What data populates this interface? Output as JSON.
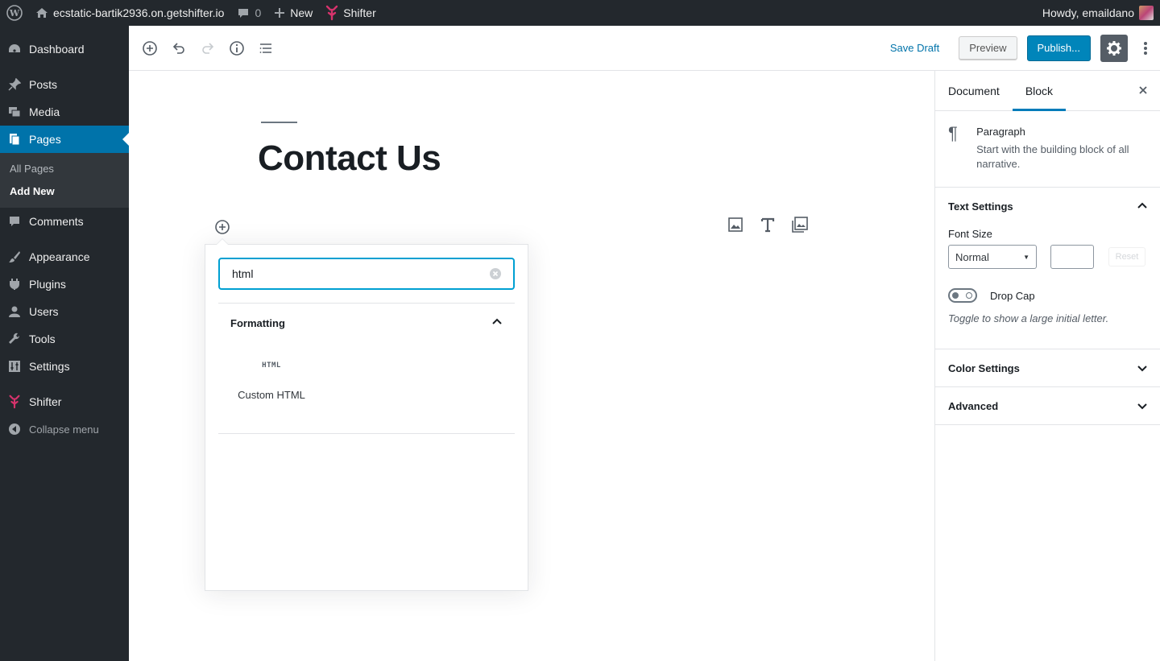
{
  "adminbar": {
    "site_name": "ecstatic-bartik2936.on.getshifter.io",
    "comments_count": "0",
    "new_label": "New",
    "shifter_label": "Shifter",
    "howdy": "Howdy, emaildano"
  },
  "sidebar": {
    "items": [
      {
        "label": "Dashboard",
        "icon": "dashboard-icon"
      },
      {
        "label": "Posts",
        "icon": "pin-icon"
      },
      {
        "label": "Media",
        "icon": "media-icon"
      },
      {
        "label": "Pages",
        "icon": "pages-icon"
      },
      {
        "label": "Comments",
        "icon": "comment-icon"
      },
      {
        "label": "Appearance",
        "icon": "brush-icon"
      },
      {
        "label": "Plugins",
        "icon": "plugin-icon"
      },
      {
        "label": "Users",
        "icon": "user-icon"
      },
      {
        "label": "Tools",
        "icon": "wrench-icon"
      },
      {
        "label": "Settings",
        "icon": "settings-icon"
      },
      {
        "label": "Shifter",
        "icon": "shifter-icon"
      }
    ],
    "submenu": [
      "All Pages",
      "Add New"
    ],
    "collapse_label": "Collapse menu",
    "accent": "#0073aa"
  },
  "header": {
    "save_draft": "Save Draft",
    "preview": "Preview",
    "publish": "Publish..."
  },
  "editor": {
    "title": "Contact Us"
  },
  "inserter": {
    "search_value": "html",
    "panel_title": "Formatting",
    "block_icon_text": "HTML",
    "block_label": "Custom HTML"
  },
  "settings": {
    "tabs": [
      "Document",
      "Block"
    ],
    "block_name": "Paragraph",
    "block_description": "Start with the building block of all narrative.",
    "text_settings": "Text Settings",
    "font_size_label": "Font Size",
    "font_size_value": "Normal",
    "reset_label": "Reset",
    "drop_cap_label": "Drop Cap",
    "drop_cap_help": "Toggle to show a large initial letter.",
    "color_settings": "Color Settings",
    "advanced": "Advanced"
  }
}
